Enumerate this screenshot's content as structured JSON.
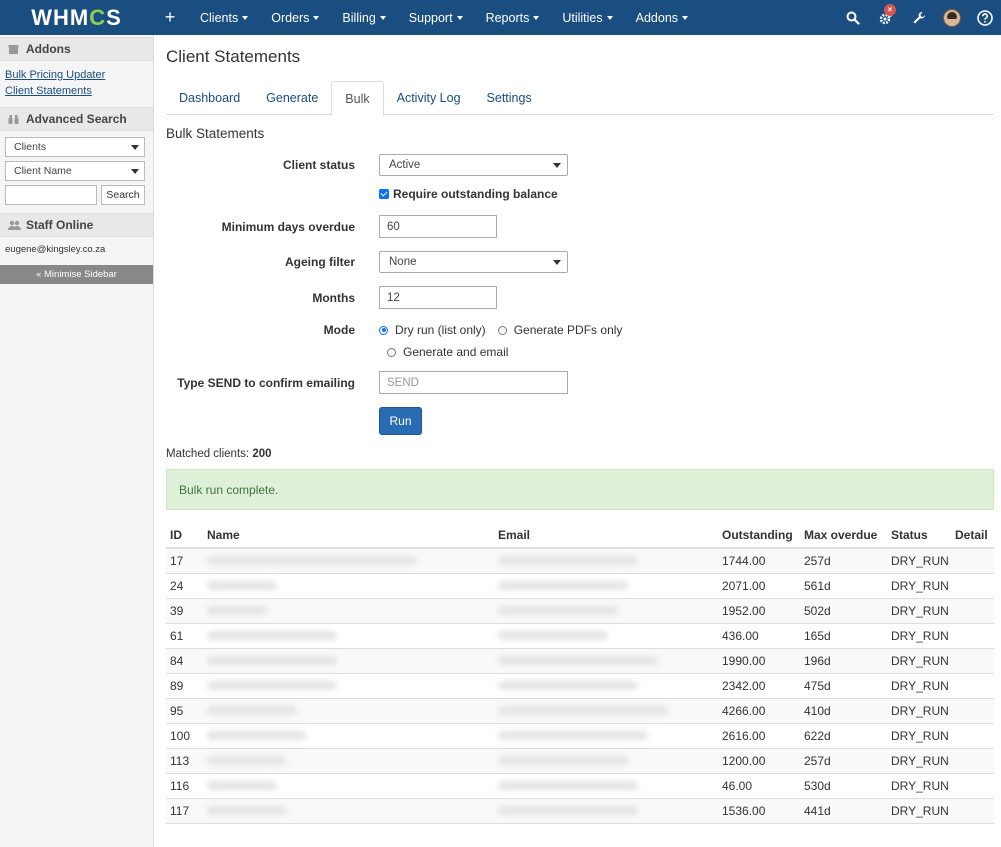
{
  "app": {
    "logo": "WHMCS",
    "logo_before": "WHM",
    "logo_gear": "C",
    "logo_after": "S"
  },
  "topnav": {
    "plus": "+",
    "items": [
      "Clients",
      "Orders",
      "Billing",
      "Support",
      "Reports",
      "Utilities",
      "Addons"
    ],
    "notification_badge": "×"
  },
  "sidebar": {
    "addons_title": "Addons",
    "addons_links": [
      "Bulk Pricing Updater",
      "Client Statements"
    ],
    "advanced_search_title": "Advanced Search",
    "search_type": "Clients",
    "search_field": "Client Name",
    "search_button": "Search",
    "staff_title": "Staff Online",
    "staff_email": "eugene@kingsley.co.za",
    "minimise": "« Minimise Sidebar"
  },
  "page": {
    "title": "Client Statements",
    "tabs": [
      "Dashboard",
      "Generate",
      "Bulk",
      "Activity Log",
      "Settings"
    ],
    "active_tab": "Bulk",
    "section_title": "Bulk Statements"
  },
  "form": {
    "client_status_label": "Client status",
    "client_status_value": "Active",
    "require_outstanding_label": "Require outstanding balance",
    "min_days_label": "Minimum days overdue",
    "min_days_value": "60",
    "ageing_label": "Ageing filter",
    "ageing_value": "None",
    "months_label": "Months",
    "months_value": "12",
    "mode_label": "Mode",
    "mode_options": [
      "Dry run (list only)",
      "Generate PDFs only",
      "Generate and email"
    ],
    "confirm_label": "Type SEND to confirm emailing",
    "confirm_placeholder": "SEND",
    "run_button": "Run"
  },
  "results": {
    "matched_label": "Matched clients:",
    "matched_count": "200",
    "alert": "Bulk run complete.",
    "columns": [
      "ID",
      "Name",
      "Email",
      "Outstanding",
      "Max overdue",
      "Status",
      "Detail"
    ],
    "rows": [
      {
        "id": "17",
        "outstanding": "1744.00",
        "max_overdue": "257d",
        "status": "DRY_RUN"
      },
      {
        "id": "24",
        "outstanding": "2071.00",
        "max_overdue": "561d",
        "status": "DRY_RUN"
      },
      {
        "id": "39",
        "outstanding": "1952.00",
        "max_overdue": "502d",
        "status": "DRY_RUN"
      },
      {
        "id": "61",
        "outstanding": "436.00",
        "max_overdue": "165d",
        "status": "DRY_RUN"
      },
      {
        "id": "84",
        "outstanding": "1990.00",
        "max_overdue": "196d",
        "status": "DRY_RUN"
      },
      {
        "id": "89",
        "outstanding": "2342.00",
        "max_overdue": "475d",
        "status": "DRY_RUN"
      },
      {
        "id": "95",
        "outstanding": "4266.00",
        "max_overdue": "410d",
        "status": "DRY_RUN"
      },
      {
        "id": "100",
        "outstanding": "2616.00",
        "max_overdue": "622d",
        "status": "DRY_RUN"
      },
      {
        "id": "113",
        "outstanding": "1200.00",
        "max_overdue": "257d",
        "status": "DRY_RUN"
      },
      {
        "id": "116",
        "outstanding": "46.00",
        "max_overdue": "530d",
        "status": "DRY_RUN"
      },
      {
        "id": "117",
        "outstanding": "1536.00",
        "max_overdue": "441d",
        "status": "DRY_RUN"
      }
    ]
  }
}
